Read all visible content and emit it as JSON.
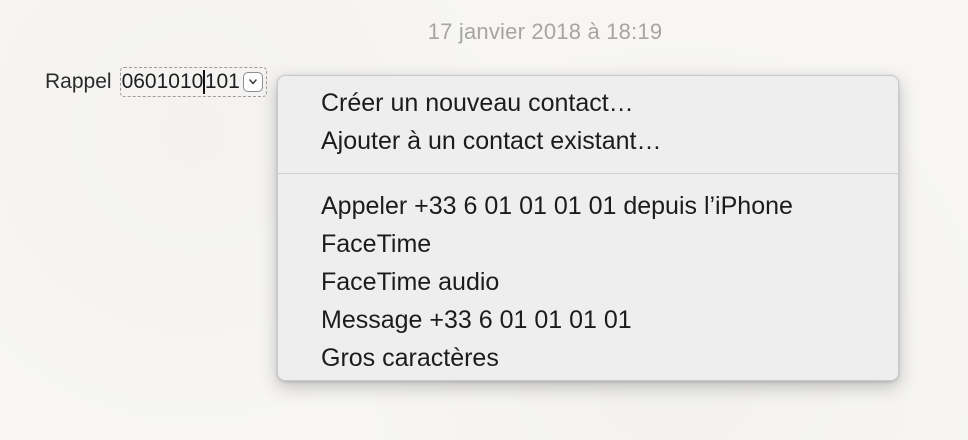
{
  "note": {
    "timestamp": "17 janvier 2018 à 18:19",
    "label": "Rappel",
    "phone_before_caret": "0601010",
    "phone_after_caret": "101",
    "detector_arrow_icon": "chevron-down-icon"
  },
  "menu": {
    "group1": [
      {
        "label": "Créer un nouveau contact…"
      },
      {
        "label": "Ajouter à un contact existant…"
      }
    ],
    "group2": [
      {
        "label": "Appeler +33 6 01 01 01 01 depuis l’iPhone"
      },
      {
        "label": "FaceTime"
      },
      {
        "label": "FaceTime audio"
      },
      {
        "label": "Message +33 6 01 01 01 01"
      },
      {
        "label": "Gros caractères"
      }
    ]
  }
}
